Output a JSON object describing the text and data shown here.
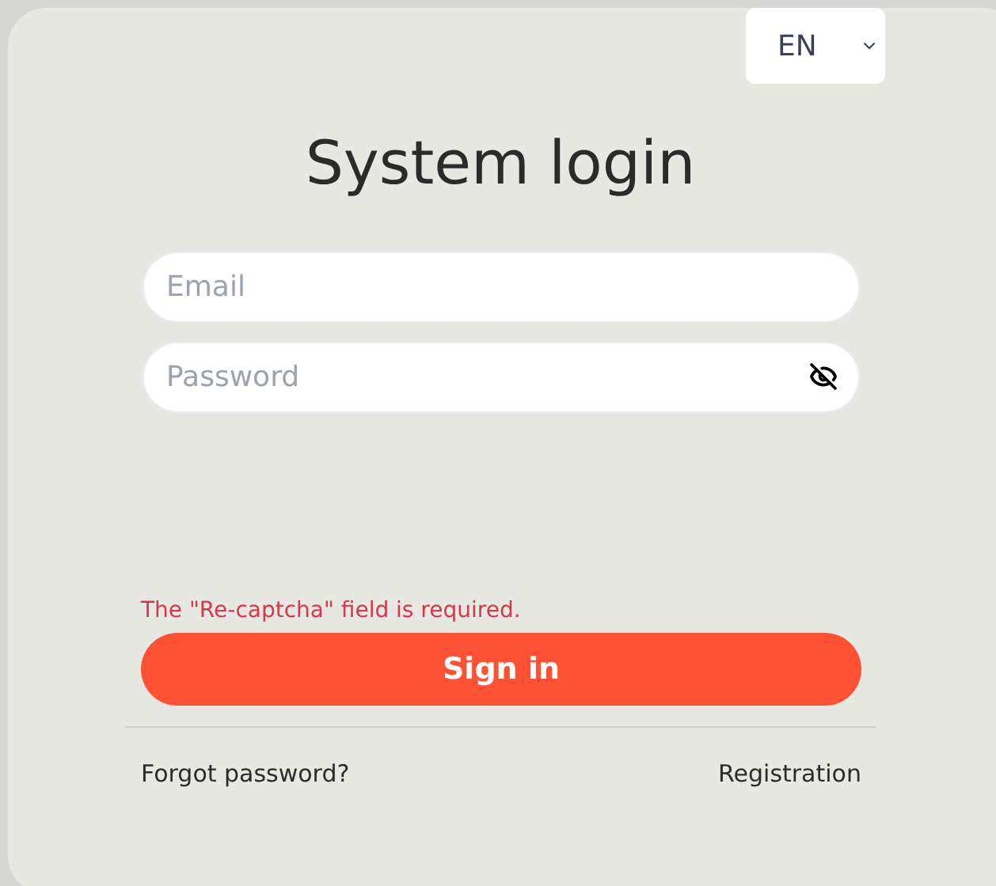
{
  "language": {
    "value": "EN"
  },
  "title": "System login",
  "fields": [
    {
      "placeholder": "Email",
      "kind": "text"
    },
    {
      "placeholder": "Password",
      "kind": "password"
    }
  ],
  "error": "The \"Re-captcha\" field is required.",
  "submit": "Sign in",
  "links": [
    "Forgot password?",
    "Registration"
  ]
}
